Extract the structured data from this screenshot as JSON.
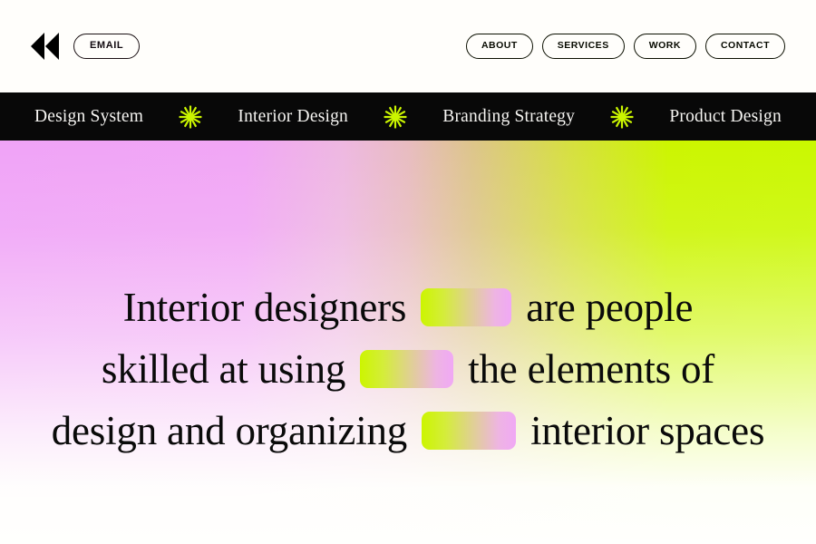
{
  "header": {
    "rewind_icon": "rewind-double-arrow-icon",
    "email_label": "EMAIL",
    "nav": [
      {
        "label": "ABOUT"
      },
      {
        "label": "SERVICES"
      },
      {
        "label": "WORK"
      },
      {
        "label": "CONTACT"
      }
    ]
  },
  "ticker": {
    "items": [
      {
        "label": "Design System"
      },
      {
        "label": "Interior Design"
      },
      {
        "label": "Branding Strategy"
      },
      {
        "label": "Product Design"
      }
    ],
    "separator_icon": "starburst-icon"
  },
  "hero": {
    "headline": {
      "line1_before": "Interior designers",
      "line1_after": "are people",
      "line2_before": "skilled at using",
      "line2_after": "the elements of",
      "line3_before": "design and organizing",
      "line3_after": "interior spaces"
    }
  },
  "colors": {
    "pink": "#f0a3f7",
    "lime": "#ccf500",
    "tan": "#e2c28f",
    "black": "#080808",
    "white": "#fffffd"
  }
}
